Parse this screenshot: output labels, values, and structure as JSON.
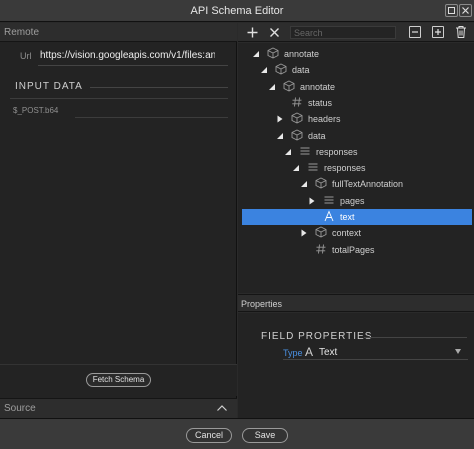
{
  "window": {
    "title": "API Schema Editor"
  },
  "left": {
    "remote_label": "Remote",
    "url_label": "Url",
    "url_value": "https://vision.googleapis.com/v1/files:an",
    "input_data_label": "INPUT DATA",
    "post_label": "$_POST.b64",
    "fetch_label": "Fetch Schema",
    "source_label": "Source"
  },
  "toolbar": {
    "add_icon": "plus-icon",
    "remove_icon": "x-icon",
    "search_placeholder": "Search",
    "collapse_icon": "minus-box-icon",
    "expand_icon": "plus-box-icon",
    "delete_icon": "trash-icon"
  },
  "tree": [
    {
      "label": "annotate",
      "icon": "cube-icon",
      "arrow": "down",
      "depth": 0
    },
    {
      "label": "data",
      "icon": "cube-icon",
      "arrow": "down",
      "depth": 1
    },
    {
      "label": "annotate",
      "icon": "cube-icon",
      "arrow": "down",
      "depth": 2
    },
    {
      "label": "status",
      "icon": "hash-icon",
      "arrow": "none",
      "depth": 3
    },
    {
      "label": "headers",
      "icon": "cube-icon",
      "arrow": "right",
      "depth": 3
    },
    {
      "label": "data",
      "icon": "cube-icon",
      "arrow": "down",
      "depth": 3
    },
    {
      "label": "responses",
      "icon": "list-icon",
      "arrow": "down",
      "depth": 4
    },
    {
      "label": "responses",
      "icon": "list-icon",
      "arrow": "down",
      "depth": 5
    },
    {
      "label": "fullTextAnnotation",
      "icon": "cube-icon",
      "arrow": "down",
      "depth": 6
    },
    {
      "label": "pages",
      "icon": "list-icon",
      "arrow": "right",
      "depth": 7
    },
    {
      "label": "text",
      "icon": "text-type-icon",
      "arrow": "none",
      "depth": 7,
      "selected": true
    },
    {
      "label": "context",
      "icon": "cube-icon",
      "arrow": "right",
      "depth": 6
    },
    {
      "label": "totalPages",
      "icon": "hash-icon",
      "arrow": "none",
      "depth": 6
    }
  ],
  "properties": {
    "header": "Properties",
    "field_properties_label": "FIELD PROPERTIES",
    "type_label": "Type",
    "type_icon": "text-type-icon",
    "type_value": "Text"
  },
  "footer": {
    "cancel_label": "Cancel",
    "save_label": "Save"
  },
  "colors": {
    "accent": "#3b83e0",
    "type_label": "#4a90e2"
  }
}
